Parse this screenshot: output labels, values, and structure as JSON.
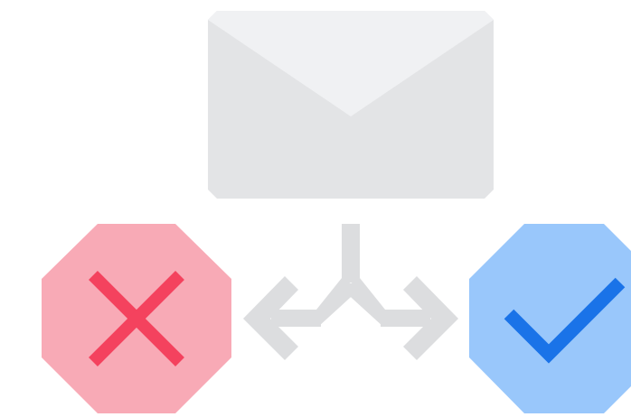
{
  "illustration": {
    "envelope": {
      "icon": "envelope-icon",
      "colors": {
        "body": "#E3E4E6",
        "flap": "#F0F1F3"
      }
    },
    "splitter": {
      "icon": "split-arrows-icon",
      "color": "#DCDDDF"
    },
    "reject": {
      "icon": "x-icon",
      "colors": {
        "badge": "#F8AAB6",
        "mark": "#F4425E"
      }
    },
    "approve": {
      "icon": "check-icon",
      "colors": {
        "badge": "#99C7FB",
        "mark": "#1A73E8"
      }
    }
  }
}
